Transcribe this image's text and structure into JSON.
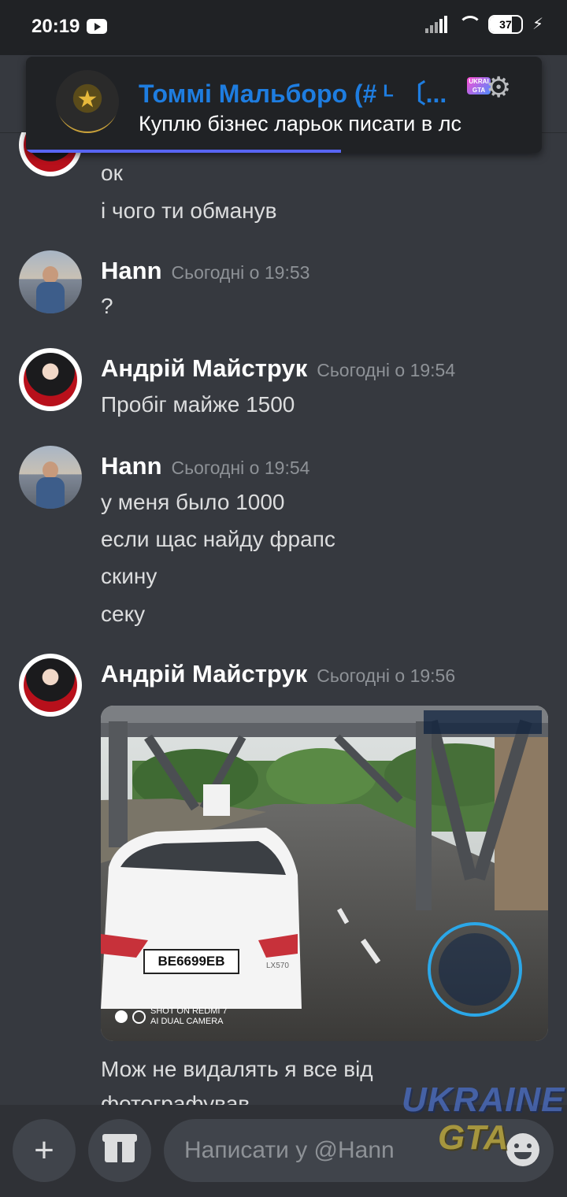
{
  "status_bar": {
    "time": "20:19",
    "battery": "37"
  },
  "notification": {
    "title": "Томмі Мальборо (# ᴸ 〔...",
    "body": "Куплю бізнес ларьок писати в лс"
  },
  "messages": [
    {
      "id": "cont",
      "lines": [
        "ок",
        "і чого ти обманув"
      ]
    },
    {
      "id": "hann-1",
      "author": "Hann",
      "time": "Сьогодні о 19:53",
      "lines": [
        "?"
      ]
    },
    {
      "id": "andrii-1",
      "author": "Андрій Майструк",
      "time": "Сьогодні о 19:54",
      "lines": [
        "Пробіг майже 1500"
      ]
    },
    {
      "id": "hann-2",
      "author": "Hann",
      "time": "Сьогодні о 19:54",
      "lines": [
        "у меня было 1000",
        "если щас найду фрапс",
        "скину",
        "секу"
      ]
    },
    {
      "id": "andrii-2",
      "author": "Андрій Майструк",
      "time": "Сьогодні о 19:56",
      "attachment": {
        "plate": "BE6699EB",
        "caption_line1": "SHOT ON REDMI 7",
        "caption_line2": "AI DUAL CAMERA",
        "model": "LX570"
      },
      "lines": [
        "Мож не видалять я все від",
        "фотографував"
      ]
    }
  ],
  "composer": {
    "placeholder": "Написати у @Hann"
  },
  "watermark": {
    "line1": "UKRAINE",
    "line2": "GTA"
  },
  "icons": [
    "signal-icon",
    "wifi-icon",
    "battery-icon",
    "charging-icon",
    "youtube-icon",
    "gear-icon",
    "plus-icon",
    "gift-icon",
    "emoji-icon"
  ]
}
